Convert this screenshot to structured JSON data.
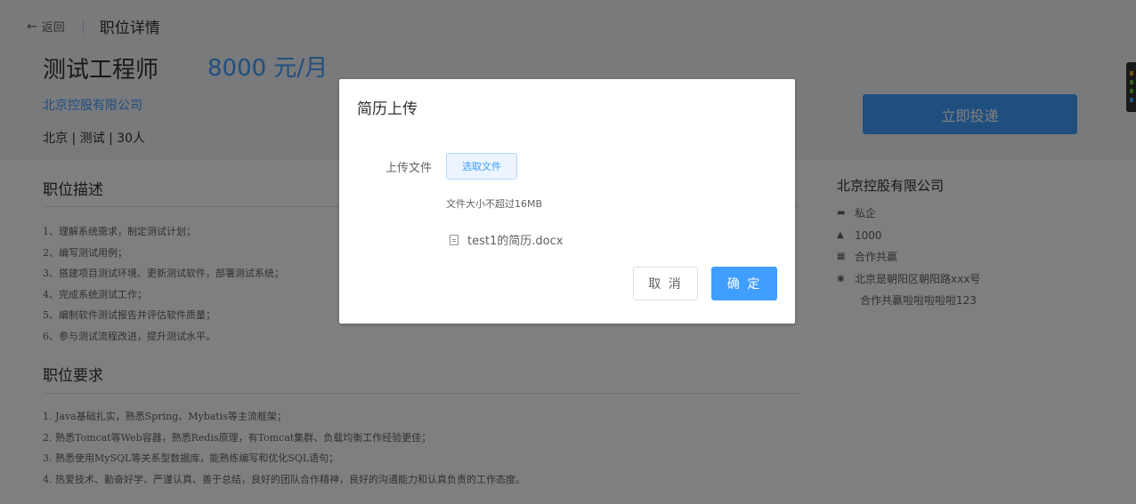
{
  "topbar": {
    "back_icon": "arrow-left-icon",
    "back_label": "返回",
    "page_title": "职位详情"
  },
  "job": {
    "title": "测试工程师",
    "salary": "8000 元/月",
    "company": "北京控股有限公司",
    "meta": "北京 | 测试 | 30人",
    "apply_label": "立即投递"
  },
  "description": {
    "title": "职位描述",
    "items": [
      "1、理解系统需求，制定测试计划；",
      "2、编写测试用例；",
      "3、搭建项目测试环境、更新测试软件，部署测试系统；",
      "4、完成系统测试工作；",
      "5、编制软件测试报告并评估软件质量；",
      "6、参与测试流程改进，提升测试水平。"
    ]
  },
  "requirements": {
    "title": "职位要求",
    "items": [
      "1. Java基础扎实，熟悉Spring、Mybatis等主流框架；",
      "2. 熟悉Tomcat等Web容器，熟悉Redis原理，有Tomcat集群、负载均衡工作经验更佳；",
      "3. 熟悉使用MySQL等关系型数据库，能熟练编写和优化SQL语句；",
      "4. 热爱技术、勤奋好学、严谨认真、善于总结，良好的团队合作精神，良好的沟通能力和认真负责的工作态度。"
    ]
  },
  "company_card": {
    "name": "北京控股有限公司",
    "type": "私企",
    "size": "1000",
    "tag": "合作共赢",
    "address": "北京是朝阳区朝阳路xxx号",
    "extra": "合作共赢啦啦啦啦啦123",
    "icons": [
      "building-icon",
      "user-icon",
      "grid-icon",
      "location-icon"
    ]
  },
  "dialog": {
    "title": "简历上传",
    "field_label": "上传文件",
    "choose_label": "选取文件",
    "tip": "文件大小不超过16MB",
    "file_icon": "document-icon",
    "file_name": "test1的简历.docx",
    "cancel_label": "取 消",
    "ok_label": "确 定"
  },
  "colors": {
    "primary": "#409eff",
    "overlay": "rgba(0,0,0,0.5)",
    "header_bg": "#f3f5f8"
  }
}
